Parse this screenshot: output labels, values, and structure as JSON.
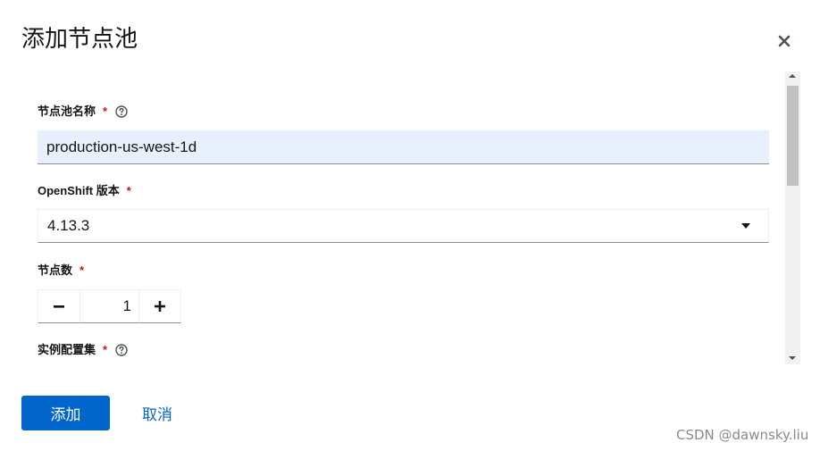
{
  "modal": {
    "title": "添加节点池"
  },
  "form": {
    "name_field": {
      "label": "节点池名称",
      "required_mark": "*",
      "value": "production-us-west-1d"
    },
    "version_field": {
      "label": "OpenShift 版本",
      "required_mark": "*",
      "selected": "4.13.3"
    },
    "count_field": {
      "label": "节点数",
      "required_mark": "*",
      "minus_symbol": "−",
      "value": "1",
      "plus_symbol": "+"
    },
    "instance_field": {
      "label": "实例配置集",
      "required_mark": "*"
    }
  },
  "footer": {
    "add_label": "添加",
    "cancel_label": "取消"
  },
  "watermark": "CSDN @dawnsky.liu",
  "colors": {
    "primary": "#0066cc",
    "required": "#c9190b",
    "autofill_bg": "#e8f0fe"
  }
}
